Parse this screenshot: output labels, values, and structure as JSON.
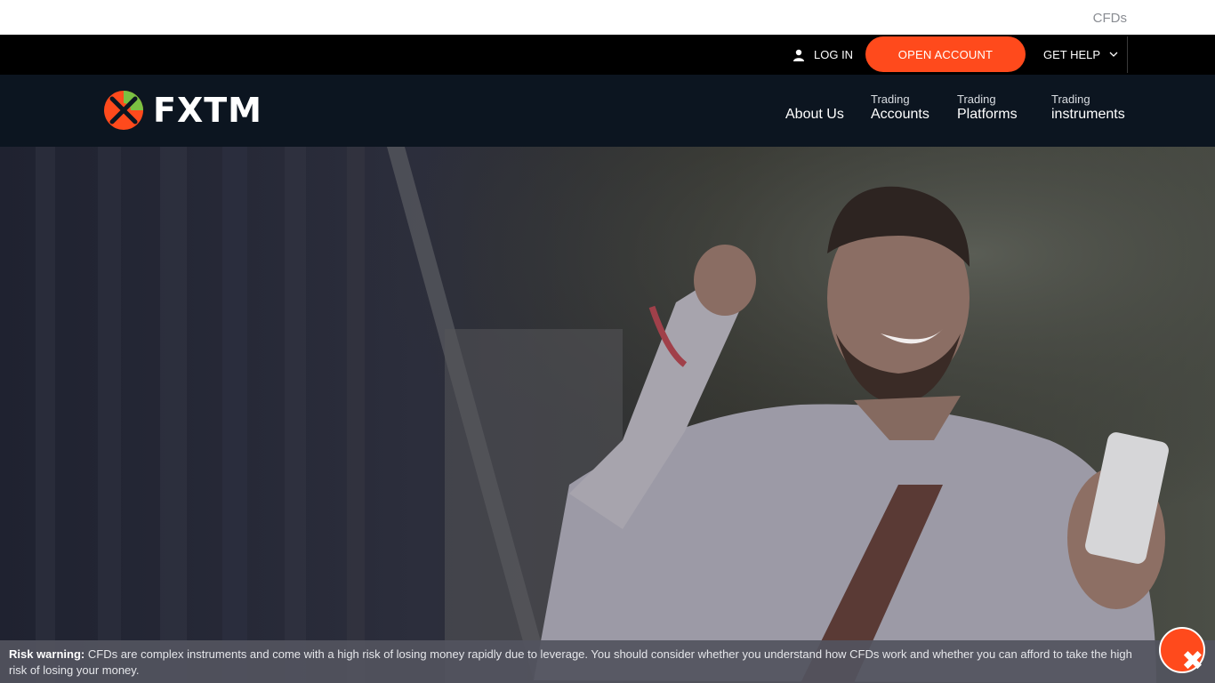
{
  "top_strip": {
    "crumb": "CFDs"
  },
  "utility_bar": {
    "login_label": "LOG IN",
    "open_account_label": "OPEN ACCOUNT",
    "get_help_label": "GET HELP"
  },
  "brand": {
    "logo_text": "FXTM",
    "accent": "#ff4a1c",
    "green": "#7ac142",
    "nav_bg": "#0c1520"
  },
  "nav": {
    "items": [
      {
        "small": "",
        "big": "About Us"
      },
      {
        "small": "Trading",
        "big": "Accounts"
      },
      {
        "small": "Trading",
        "big": "Platforms"
      },
      {
        "small": "Trading",
        "big": "instruments"
      }
    ]
  },
  "risk_banner": {
    "label": "Risk warning:",
    "text": "CFDs are complex instruments and come with a high risk of losing money rapidly due to leverage. You should consider whether you understand how CFDs work and whether you can afford to take the high risk of losing your money."
  },
  "icons": {
    "login": "user-icon",
    "help": "chevron-down-icon",
    "close": "close-icon",
    "chat": "chat-icon"
  }
}
